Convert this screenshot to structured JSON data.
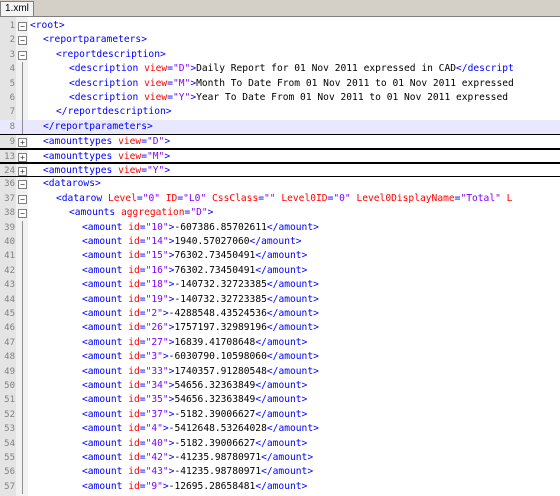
{
  "tab": {
    "label": "1.xml"
  },
  "lines": [
    {
      "n": "1",
      "fold": "minus",
      "indent": 0,
      "parts": [
        [
          "b",
          "<"
        ],
        [
          "t",
          "root"
        ],
        [
          "b",
          ">"
        ]
      ]
    },
    {
      "n": "2",
      "fold": "minus",
      "indent": 1,
      "parts": [
        [
          "b",
          "<"
        ],
        [
          "t",
          "reportparameters"
        ],
        [
          "b",
          ">"
        ]
      ]
    },
    {
      "n": "3",
      "fold": "minus",
      "indent": 2,
      "parts": [
        [
          "b",
          "<"
        ],
        [
          "t",
          "reportdescription"
        ],
        [
          "b",
          ">"
        ]
      ]
    },
    {
      "n": "4",
      "fold": "line",
      "indent": 3,
      "parts": [
        [
          "b",
          "<"
        ],
        [
          "t",
          "description "
        ],
        [
          "a",
          "view"
        ],
        [
          "b",
          "="
        ],
        [
          "v",
          "\"D\""
        ],
        [
          "b",
          ">"
        ],
        [
          "x",
          "Daily Report for 01 Nov 2011 expressed in CAD"
        ],
        [
          "b",
          "</"
        ],
        [
          "t",
          "descript"
        ]
      ]
    },
    {
      "n": "5",
      "fold": "line",
      "indent": 3,
      "parts": [
        [
          "b",
          "<"
        ],
        [
          "t",
          "description "
        ],
        [
          "a",
          "view"
        ],
        [
          "b",
          "="
        ],
        [
          "v",
          "\"M\""
        ],
        [
          "b",
          ">"
        ],
        [
          "x",
          "Month To Date From 01 Nov 2011 to 01 Nov 2011 expressed"
        ]
      ]
    },
    {
      "n": "6",
      "fold": "line",
      "indent": 3,
      "parts": [
        [
          "b",
          "<"
        ],
        [
          "t",
          "description "
        ],
        [
          "a",
          "view"
        ],
        [
          "b",
          "="
        ],
        [
          "v",
          "\"Y\""
        ],
        [
          "b",
          ">"
        ],
        [
          "x",
          "Year To Date From 01 Nov 2011 to 01 Nov 2011 expressed"
        ]
      ]
    },
    {
      "n": "7",
      "fold": "line",
      "indent": 2,
      "parts": [
        [
          "b",
          "</"
        ],
        [
          "t",
          "reportdescription"
        ],
        [
          "b",
          ">"
        ]
      ]
    },
    {
      "n": "8",
      "fold": "line",
      "indent": 1,
      "sel": true,
      "parts": [
        [
          "b",
          "</"
        ],
        [
          "t",
          "reportparameters"
        ],
        [
          "b",
          ">"
        ]
      ]
    },
    {
      "n": "9",
      "fold": "plus",
      "indent": 1,
      "boxed": true,
      "parts": [
        [
          "b",
          "<"
        ],
        [
          "t",
          "amounttypes "
        ],
        [
          "a",
          "view"
        ],
        [
          "b",
          "="
        ],
        [
          "v",
          "\"D\""
        ],
        [
          "b",
          ">"
        ]
      ]
    },
    {
      "n": "13",
      "fold": "plus",
      "indent": 1,
      "boxed": true,
      "parts": [
        [
          "b",
          "<"
        ],
        [
          "t",
          "amounttypes "
        ],
        [
          "a",
          "view"
        ],
        [
          "b",
          "="
        ],
        [
          "v",
          "\"M\""
        ],
        [
          "b",
          ">"
        ]
      ]
    },
    {
      "n": "24",
      "fold": "plus",
      "indent": 1,
      "boxed": true,
      "parts": [
        [
          "b",
          "<"
        ],
        [
          "t",
          "amounttypes "
        ],
        [
          "a",
          "view"
        ],
        [
          "b",
          "="
        ],
        [
          "v",
          "\"Y\""
        ],
        [
          "b",
          ">"
        ]
      ]
    },
    {
      "n": "36",
      "fold": "minus",
      "indent": 1,
      "parts": [
        [
          "b",
          "<"
        ],
        [
          "t",
          "datarows"
        ],
        [
          "b",
          ">"
        ]
      ]
    },
    {
      "n": "37",
      "fold": "minus",
      "indent": 2,
      "parts": [
        [
          "b",
          "<"
        ],
        [
          "t",
          "datarow "
        ],
        [
          "a",
          "Level"
        ],
        [
          "b",
          "="
        ],
        [
          "v",
          "\"0\" "
        ],
        [
          "a",
          "ID"
        ],
        [
          "b",
          "="
        ],
        [
          "v",
          "\"L0\" "
        ],
        [
          "a",
          "CssClass"
        ],
        [
          "b",
          "="
        ],
        [
          "v",
          "\"\" "
        ],
        [
          "a",
          "Level0ID"
        ],
        [
          "b",
          "="
        ],
        [
          "v",
          "\"0\" "
        ],
        [
          "a",
          "Level0DisplayName"
        ],
        [
          "b",
          "="
        ],
        [
          "v",
          "\"Total\" "
        ],
        [
          "a",
          "L"
        ]
      ]
    },
    {
      "n": "38",
      "fold": "minus",
      "indent": 3,
      "parts": [
        [
          "b",
          "<"
        ],
        [
          "t",
          "amounts "
        ],
        [
          "a",
          "aggregation"
        ],
        [
          "b",
          "="
        ],
        [
          "v",
          "\"D\""
        ],
        [
          "b",
          ">"
        ]
      ]
    },
    {
      "n": "39",
      "fold": "line",
      "indent": 4,
      "parts": [
        [
          "b",
          "<"
        ],
        [
          "t",
          "amount "
        ],
        [
          "a",
          "id"
        ],
        [
          "b",
          "="
        ],
        [
          "v",
          "\"10\""
        ],
        [
          "b",
          ">"
        ],
        [
          "x",
          "-607386.85702611"
        ],
        [
          "b",
          "</"
        ],
        [
          "t",
          "amount"
        ],
        [
          "b",
          ">"
        ]
      ]
    },
    {
      "n": "40",
      "fold": "line",
      "indent": 4,
      "parts": [
        [
          "b",
          "<"
        ],
        [
          "t",
          "amount "
        ],
        [
          "a",
          "id"
        ],
        [
          "b",
          "="
        ],
        [
          "v",
          "\"14\""
        ],
        [
          "b",
          ">"
        ],
        [
          "x",
          "1940.57027060"
        ],
        [
          "b",
          "</"
        ],
        [
          "t",
          "amount"
        ],
        [
          "b",
          ">"
        ]
      ]
    },
    {
      "n": "41",
      "fold": "line",
      "indent": 4,
      "parts": [
        [
          "b",
          "<"
        ],
        [
          "t",
          "amount "
        ],
        [
          "a",
          "id"
        ],
        [
          "b",
          "="
        ],
        [
          "v",
          "\"15\""
        ],
        [
          "b",
          ">"
        ],
        [
          "x",
          "76302.73450491"
        ],
        [
          "b",
          "</"
        ],
        [
          "t",
          "amount"
        ],
        [
          "b",
          ">"
        ]
      ]
    },
    {
      "n": "42",
      "fold": "line",
      "indent": 4,
      "parts": [
        [
          "b",
          "<"
        ],
        [
          "t",
          "amount "
        ],
        [
          "a",
          "id"
        ],
        [
          "b",
          "="
        ],
        [
          "v",
          "\"16\""
        ],
        [
          "b",
          ">"
        ],
        [
          "x",
          "76302.73450491"
        ],
        [
          "b",
          "</"
        ],
        [
          "t",
          "amount"
        ],
        [
          "b",
          ">"
        ]
      ]
    },
    {
      "n": "43",
      "fold": "line",
      "indent": 4,
      "parts": [
        [
          "b",
          "<"
        ],
        [
          "t",
          "amount "
        ],
        [
          "a",
          "id"
        ],
        [
          "b",
          "="
        ],
        [
          "v",
          "\"18\""
        ],
        [
          "b",
          ">"
        ],
        [
          "x",
          "-140732.32723385"
        ],
        [
          "b",
          "</"
        ],
        [
          "t",
          "amount"
        ],
        [
          "b",
          ">"
        ]
      ]
    },
    {
      "n": "44",
      "fold": "line",
      "indent": 4,
      "parts": [
        [
          "b",
          "<"
        ],
        [
          "t",
          "amount "
        ],
        [
          "a",
          "id"
        ],
        [
          "b",
          "="
        ],
        [
          "v",
          "\"19\""
        ],
        [
          "b",
          ">"
        ],
        [
          "x",
          "-140732.32723385"
        ],
        [
          "b",
          "</"
        ],
        [
          "t",
          "amount"
        ],
        [
          "b",
          ">"
        ]
      ]
    },
    {
      "n": "45",
      "fold": "line",
      "indent": 4,
      "parts": [
        [
          "b",
          "<"
        ],
        [
          "t",
          "amount "
        ],
        [
          "a",
          "id"
        ],
        [
          "b",
          "="
        ],
        [
          "v",
          "\"2\""
        ],
        [
          "b",
          ">"
        ],
        [
          "x",
          "-4288548.43524536"
        ],
        [
          "b",
          "</"
        ],
        [
          "t",
          "amount"
        ],
        [
          "b",
          ">"
        ]
      ]
    },
    {
      "n": "46",
      "fold": "line",
      "indent": 4,
      "parts": [
        [
          "b",
          "<"
        ],
        [
          "t",
          "amount "
        ],
        [
          "a",
          "id"
        ],
        [
          "b",
          "="
        ],
        [
          "v",
          "\"26\""
        ],
        [
          "b",
          ">"
        ],
        [
          "x",
          "1757197.32989196"
        ],
        [
          "b",
          "</"
        ],
        [
          "t",
          "amount"
        ],
        [
          "b",
          ">"
        ]
      ]
    },
    {
      "n": "47",
      "fold": "line",
      "indent": 4,
      "parts": [
        [
          "b",
          "<"
        ],
        [
          "t",
          "amount "
        ],
        [
          "a",
          "id"
        ],
        [
          "b",
          "="
        ],
        [
          "v",
          "\"27\""
        ],
        [
          "b",
          ">"
        ],
        [
          "x",
          "16839.41708648"
        ],
        [
          "b",
          "</"
        ],
        [
          "t",
          "amount"
        ],
        [
          "b",
          ">"
        ]
      ]
    },
    {
      "n": "48",
      "fold": "line",
      "indent": 4,
      "parts": [
        [
          "b",
          "<"
        ],
        [
          "t",
          "amount "
        ],
        [
          "a",
          "id"
        ],
        [
          "b",
          "="
        ],
        [
          "v",
          "\"3\""
        ],
        [
          "b",
          ">"
        ],
        [
          "x",
          "-6030790.10598060"
        ],
        [
          "b",
          "</"
        ],
        [
          "t",
          "amount"
        ],
        [
          "b",
          ">"
        ]
      ]
    },
    {
      "n": "49",
      "fold": "line",
      "indent": 4,
      "parts": [
        [
          "b",
          "<"
        ],
        [
          "t",
          "amount "
        ],
        [
          "a",
          "id"
        ],
        [
          "b",
          "="
        ],
        [
          "v",
          "\"33\""
        ],
        [
          "b",
          ">"
        ],
        [
          "x",
          "1740357.91280548"
        ],
        [
          "b",
          "</"
        ],
        [
          "t",
          "amount"
        ],
        [
          "b",
          ">"
        ]
      ]
    },
    {
      "n": "50",
      "fold": "line",
      "indent": 4,
      "parts": [
        [
          "b",
          "<"
        ],
        [
          "t",
          "amount "
        ],
        [
          "a",
          "id"
        ],
        [
          "b",
          "="
        ],
        [
          "v",
          "\"34\""
        ],
        [
          "b",
          ">"
        ],
        [
          "x",
          "54656.32363849"
        ],
        [
          "b",
          "</"
        ],
        [
          "t",
          "amount"
        ],
        [
          "b",
          ">"
        ]
      ]
    },
    {
      "n": "51",
      "fold": "line",
      "indent": 4,
      "parts": [
        [
          "b",
          "<"
        ],
        [
          "t",
          "amount "
        ],
        [
          "a",
          "id"
        ],
        [
          "b",
          "="
        ],
        [
          "v",
          "\"35\""
        ],
        [
          "b",
          ">"
        ],
        [
          "x",
          "54656.32363849"
        ],
        [
          "b",
          "</"
        ],
        [
          "t",
          "amount"
        ],
        [
          "b",
          ">"
        ]
      ]
    },
    {
      "n": "52",
      "fold": "line",
      "indent": 4,
      "parts": [
        [
          "b",
          "<"
        ],
        [
          "t",
          "amount "
        ],
        [
          "a",
          "id"
        ],
        [
          "b",
          "="
        ],
        [
          "v",
          "\"37\""
        ],
        [
          "b",
          ">"
        ],
        [
          "x",
          "-5182.39006627"
        ],
        [
          "b",
          "</"
        ],
        [
          "t",
          "amount"
        ],
        [
          "b",
          ">"
        ]
      ]
    },
    {
      "n": "53",
      "fold": "line",
      "indent": 4,
      "parts": [
        [
          "b",
          "<"
        ],
        [
          "t",
          "amount "
        ],
        [
          "a",
          "id"
        ],
        [
          "b",
          "="
        ],
        [
          "v",
          "\"4\""
        ],
        [
          "b",
          ">"
        ],
        [
          "x",
          "-5412648.53264028"
        ],
        [
          "b",
          "</"
        ],
        [
          "t",
          "amount"
        ],
        [
          "b",
          ">"
        ]
      ]
    },
    {
      "n": "54",
      "fold": "line",
      "indent": 4,
      "parts": [
        [
          "b",
          "<"
        ],
        [
          "t",
          "amount "
        ],
        [
          "a",
          "id"
        ],
        [
          "b",
          "="
        ],
        [
          "v",
          "\"40\""
        ],
        [
          "b",
          ">"
        ],
        [
          "x",
          "-5182.39006627"
        ],
        [
          "b",
          "</"
        ],
        [
          "t",
          "amount"
        ],
        [
          "b",
          ">"
        ]
      ]
    },
    {
      "n": "55",
      "fold": "line",
      "indent": 4,
      "parts": [
        [
          "b",
          "<"
        ],
        [
          "t",
          "amount "
        ],
        [
          "a",
          "id"
        ],
        [
          "b",
          "="
        ],
        [
          "v",
          "\"42\""
        ],
        [
          "b",
          ">"
        ],
        [
          "x",
          "-41235.98780971"
        ],
        [
          "b",
          "</"
        ],
        [
          "t",
          "amount"
        ],
        [
          "b",
          ">"
        ]
      ]
    },
    {
      "n": "56",
      "fold": "line",
      "indent": 4,
      "parts": [
        [
          "b",
          "<"
        ],
        [
          "t",
          "amount "
        ],
        [
          "a",
          "id"
        ],
        [
          "b",
          "="
        ],
        [
          "v",
          "\"43\""
        ],
        [
          "b",
          ">"
        ],
        [
          "x",
          "-41235.98780971"
        ],
        [
          "b",
          "</"
        ],
        [
          "t",
          "amount"
        ],
        [
          "b",
          ">"
        ]
      ]
    },
    {
      "n": "57",
      "fold": "line",
      "indent": 4,
      "parts": [
        [
          "b",
          "<"
        ],
        [
          "t",
          "amount "
        ],
        [
          "a",
          "id"
        ],
        [
          "b",
          "="
        ],
        [
          "v",
          "\"9\""
        ],
        [
          "b",
          ">"
        ],
        [
          "x",
          "-12695.28658481"
        ],
        [
          "b",
          "</"
        ],
        [
          "t",
          "amount"
        ],
        [
          "b",
          ">"
        ]
      ]
    }
  ]
}
